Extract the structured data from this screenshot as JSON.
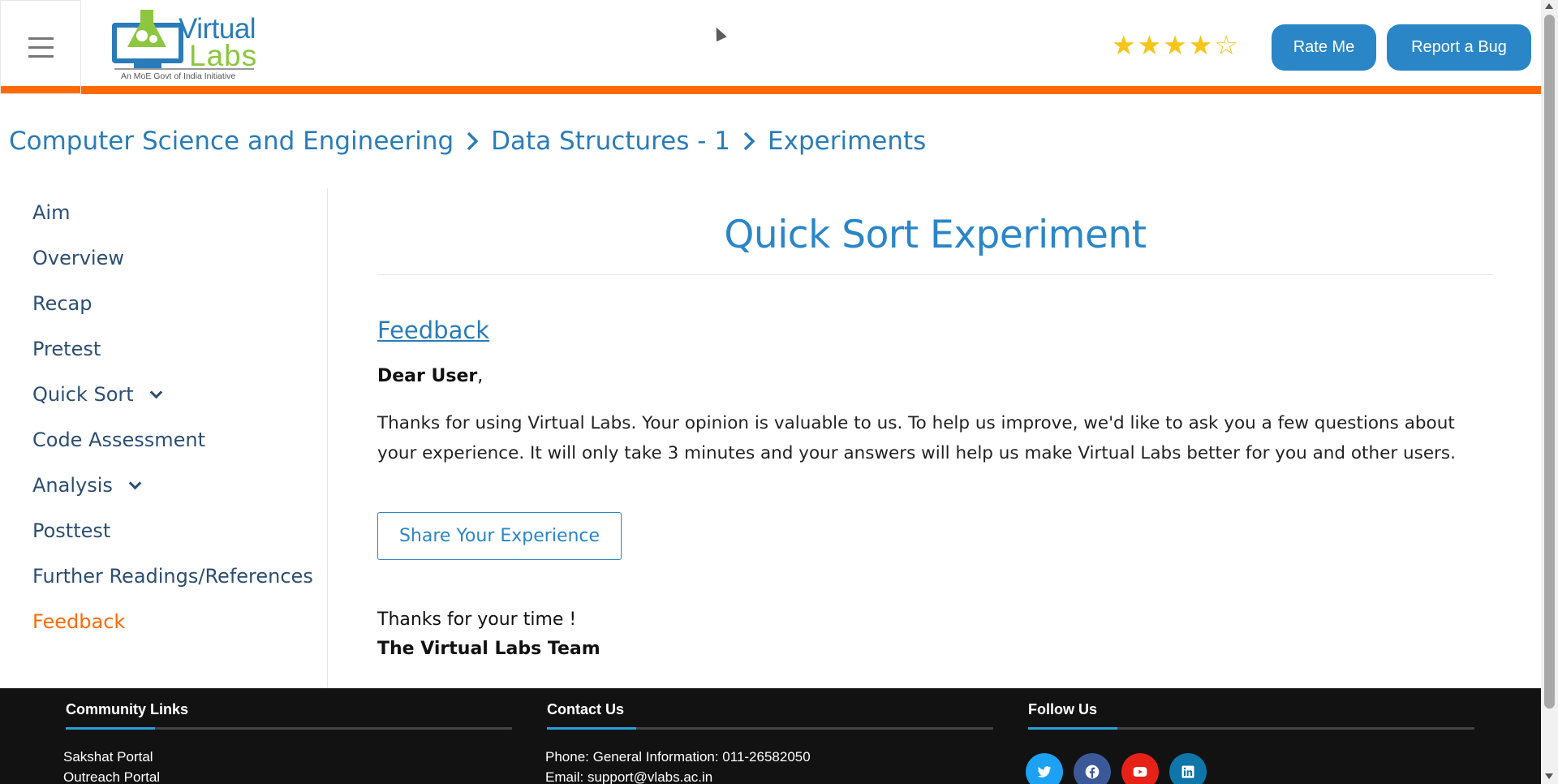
{
  "header": {
    "logo": {
      "word1": "Virtual",
      "word2": "Labs",
      "tagline": "An MoE Govt of India Initiative"
    },
    "rating": {
      "value": 4,
      "max": 5,
      "color": "#f5c518"
    },
    "rate_label": "Rate Me",
    "bug_label": "Report a Bug",
    "accent_bar_color": "#ff6a00",
    "button_color": "#2a86c7"
  },
  "breadcrumb": {
    "items": [
      "Computer Science and Engineering",
      "Data Structures - 1",
      "Experiments"
    ],
    "separator_icon": "chevron-right-icon"
  },
  "sidebar": {
    "items": [
      {
        "label": "Aim",
        "expandable": false,
        "active": false
      },
      {
        "label": "Overview",
        "expandable": false,
        "active": false
      },
      {
        "label": "Recap",
        "expandable": false,
        "active": false
      },
      {
        "label": "Pretest",
        "expandable": false,
        "active": false
      },
      {
        "label": "Quick Sort",
        "expandable": true,
        "active": false
      },
      {
        "label": "Code Assessment",
        "expandable": false,
        "active": false
      },
      {
        "label": "Analysis",
        "expandable": true,
        "active": false
      },
      {
        "label": "Posttest",
        "expandable": false,
        "active": false
      },
      {
        "label": "Further Readings/References",
        "expandable": false,
        "active": false
      },
      {
        "label": "Feedback",
        "expandable": false,
        "active": true
      }
    ],
    "active_color": "#ff6a00"
  },
  "main": {
    "title": "Quick Sort Experiment",
    "section_heading": "Feedback",
    "greeting_bold": "Dear User",
    "greeting_tail": ",",
    "body": "Thanks for using Virtual Labs. Your opinion is valuable to us. To help us improve, we'd like to ask you a few questions about your experience. It will only take 3 minutes and your answers will help us make Virtual Labs better for you and other users.",
    "share_label": "Share Your Experience",
    "thanks": "Thanks for your time !",
    "signature": "The Virtual Labs Team"
  },
  "footer": {
    "community": {
      "heading": "Community Links",
      "links": [
        "Sakshat Portal",
        "Outreach Portal"
      ]
    },
    "contact": {
      "heading": "Contact Us",
      "phone": "Phone: General Information: 011-26582050",
      "email": "Email: support@vlabs.ac.in"
    },
    "follow": {
      "heading": "Follow Us",
      "networks": [
        {
          "name": "twitter-icon",
          "color": "#1da1f2"
        },
        {
          "name": "facebook-icon",
          "color": "#3b5998"
        },
        {
          "name": "youtube-icon",
          "color": "#e62117"
        },
        {
          "name": "linkedin-icon",
          "color": "#0e76a8"
        }
      ]
    },
    "accent_color": "#2a9fd6"
  }
}
